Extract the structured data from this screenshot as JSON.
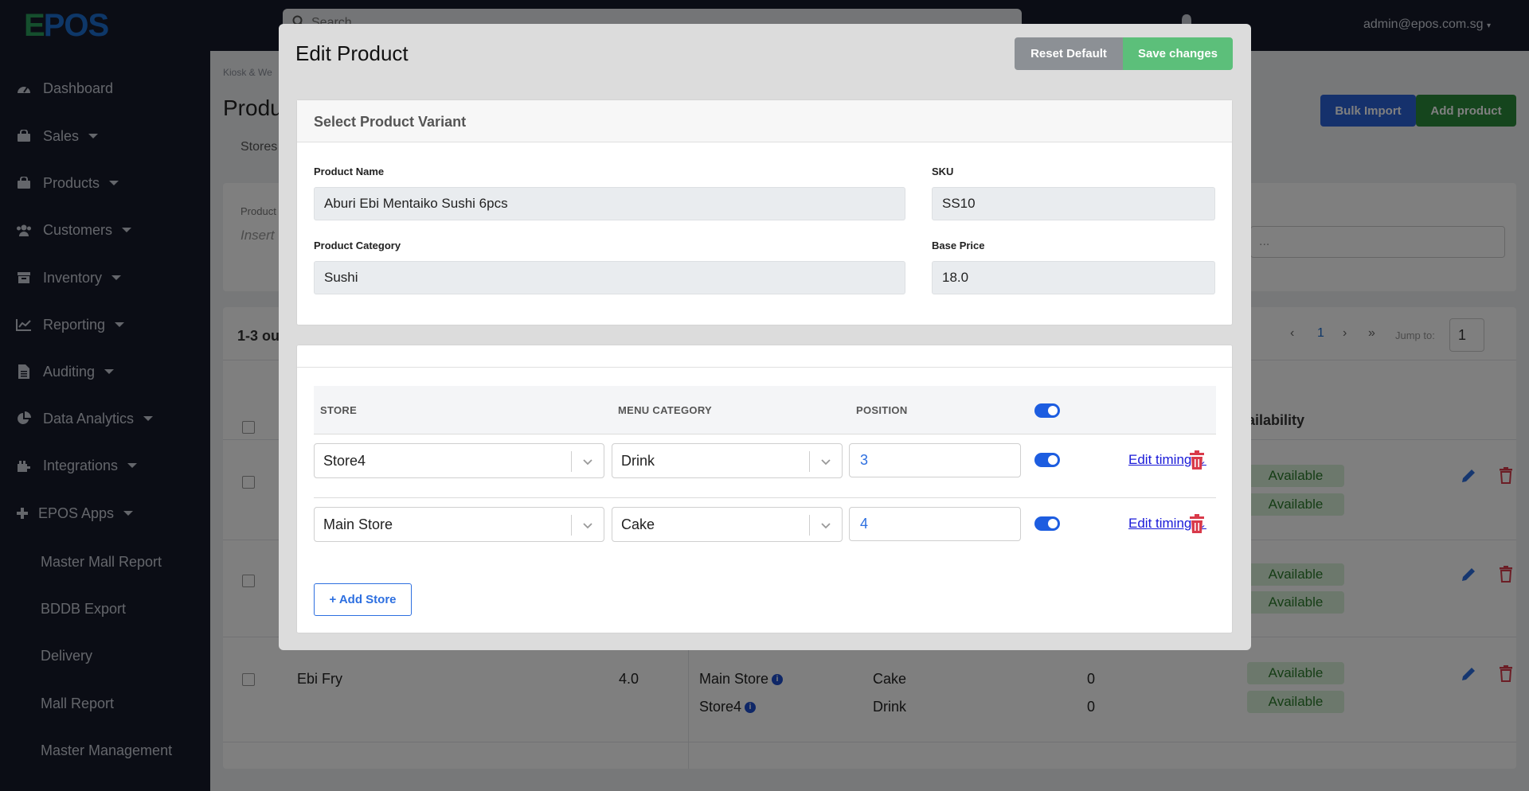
{
  "topbar": {
    "logo_mark": "E",
    "logo_text": "POS",
    "search_placeholder": "Search",
    "user": "admin@epos.com.sg"
  },
  "sidebar": {
    "items": [
      {
        "label": "Dashboard",
        "icon": "dashboard-icon"
      },
      {
        "label": "Sales",
        "icon": "shopping-bag-icon"
      },
      {
        "label": "Products",
        "icon": "shopping-bag-icon"
      },
      {
        "label": "Customers",
        "icon": "users-icon"
      },
      {
        "label": "Inventory",
        "icon": "archive-icon"
      },
      {
        "label": "Reporting",
        "icon": "chart-line-icon"
      },
      {
        "label": "Auditing",
        "icon": "file-icon"
      },
      {
        "label": "Data Analytics",
        "icon": "pie-chart-icon"
      },
      {
        "label": "Integrations",
        "icon": "plug-icon"
      },
      {
        "label": "EPOS Apps",
        "icon": "plus-icon"
      }
    ],
    "subitems": [
      "Master Mall Report",
      "BDDB Export",
      "Delivery",
      "Mall Report",
      "Master Management"
    ]
  },
  "background": {
    "breadcrumb": "Kiosk & We",
    "title": "Produ",
    "tab": "Stores",
    "bulk_import": "Bulk Import",
    "add_product": "Add product",
    "filter_label": "Product",
    "filter_placeholder": "Insert",
    "select_placeholder": "...",
    "count": "1-3 ou",
    "pagination": {
      "prev": "‹",
      "page": "1",
      "next": "›",
      "last": "»",
      "jump_label": "Jump to:",
      "jump_value": "1"
    },
    "availability_header": "ailability",
    "available": "Available",
    "last_row": {
      "name": "Ebi Fry",
      "price": "4.0",
      "stores": [
        "Main Store",
        "Store4"
      ],
      "categories": [
        "Cake",
        "Drink"
      ],
      "positions": [
        "0",
        "0"
      ]
    }
  },
  "modal": {
    "title": "Edit Product",
    "reset_label": "Reset Default",
    "save_label": "Save changes",
    "variant_header": "Select Product Variant",
    "fields": {
      "product_name_label": "Product Name",
      "product_name": "Aburi Ebi Mentaiko Sushi 6pcs",
      "sku_label": "SKU",
      "sku": "SS10",
      "category_label": "Product Category",
      "category": "Sushi",
      "price_label": "Base Price",
      "price": "18.0"
    },
    "table": {
      "headers": {
        "store": "STORE",
        "menu_category": "MENU CATEGORY",
        "position": "POSITION"
      },
      "rows": [
        {
          "store": "Store4",
          "menu_category": "Drink",
          "position": "3",
          "enabled": true
        },
        {
          "store": "Main Store",
          "menu_category": "Cake",
          "position": "4",
          "enabled": true
        }
      ],
      "edit_timings_label": "Edit timings"
    },
    "add_store_label": "+ Add Store"
  },
  "colors": {
    "sidebar_bg": "#161a2b",
    "primary": "#2d6fe0",
    "save_green": "#5cbf7a",
    "danger": "#d93a4a"
  }
}
